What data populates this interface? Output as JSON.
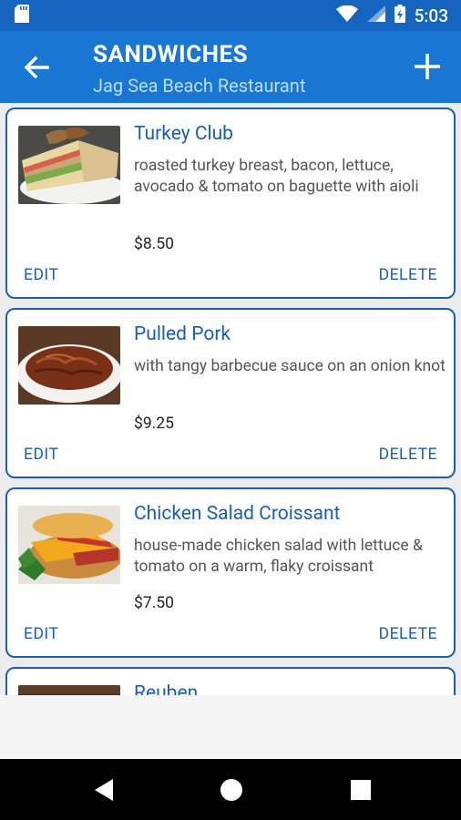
{
  "status_bar": {
    "time": "5:03"
  },
  "toolbar": {
    "title": "SANDWICHES",
    "subtitle": "Jag Sea Beach Restaurant"
  },
  "items": [
    {
      "name": "Turkey Club",
      "description": "roasted turkey breast, bacon, lettuce, avocado & tomato on baguette with aioli",
      "price": "$8.50",
      "edit_label": "EDIT",
      "delete_label": "DELETE"
    },
    {
      "name": "Pulled Pork",
      "description": "with tangy barbecue sauce on an onion knot",
      "price": "$9.25",
      "edit_label": "EDIT",
      "delete_label": "DELETE"
    },
    {
      "name": "Chicken Salad Croissant",
      "description": "house-made chicken salad with lettuce & tomato on a warm, flaky croissant",
      "price": "$7.50",
      "edit_label": "EDIT",
      "delete_label": "DELETE"
    },
    {
      "name": "Reuben"
    }
  ],
  "colors": {
    "status_bar": "#1565c0",
    "toolbar": "#1976d2",
    "accent": "#1a5fb4",
    "background": "#ececec"
  }
}
